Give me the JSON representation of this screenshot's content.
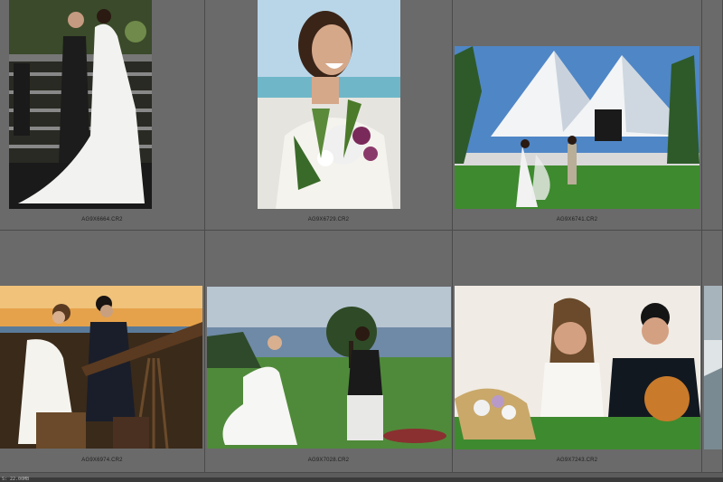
{
  "grid": {
    "thumbnails": [
      {
        "filename": "AG9X6664.CR2"
      },
      {
        "filename": "AG9X6729.CR2"
      },
      {
        "filename": "AG9X6741.CR2"
      },
      {
        "filename": "AG9X6974.CR2"
      },
      {
        "filename": "AG9X7028.CR2"
      },
      {
        "filename": "AG9X7243.CR2"
      }
    ]
  },
  "statusbar": {
    "text": "S: 22.00MB"
  },
  "colors": {
    "cell_background": "#6a6a6a",
    "grid_background": "#5c5c5c",
    "grid_border": "#4a4a4a",
    "caption_text": "#1e1e1e"
  }
}
